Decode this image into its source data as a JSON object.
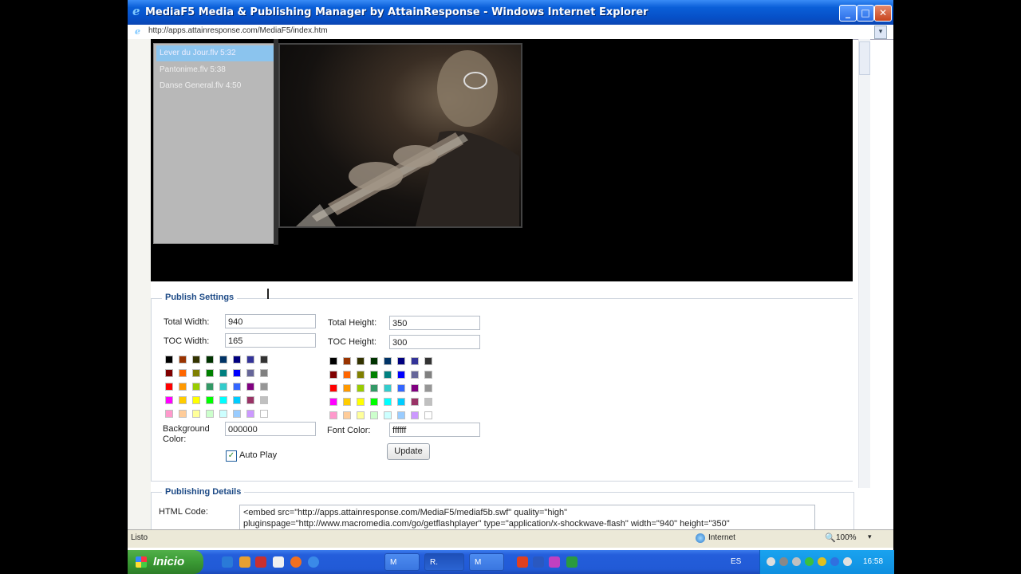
{
  "window": {
    "title": "MediaF5 Media & Publishing Manager by AttainResponse - Windows Internet Explorer",
    "address": "http://apps.attainresponse.com/MediaF5/index.htm"
  },
  "player": {
    "playlist": [
      {
        "label": "Lever du Jour.flv    5:32",
        "selected": true
      },
      {
        "label": "Pantonime.flv    5:38",
        "selected": false
      },
      {
        "label": "Danse General.flv    4:50",
        "selected": false
      }
    ]
  },
  "publish_settings": {
    "legend": "Publish Settings",
    "total_width_label": "Total Width:",
    "total_width_value": "940",
    "toc_width_label": "TOC Width:",
    "toc_width_value": "165",
    "total_height_label": "Total Height:",
    "total_height_value": "350",
    "toc_height_label": "TOC Height:",
    "toc_height_value": "300",
    "background_color_label_1": "Background",
    "background_color_label_2": "Color:",
    "background_color_value": "000000",
    "font_color_label": "Font Color:",
    "font_color_value": "ffffff",
    "auto_play_label": "Auto Play",
    "auto_play_checked": true,
    "update_button": "Update",
    "palette": [
      [
        "#000000",
        "#993300",
        "#333300",
        "#003300",
        "#003366",
        "#000080",
        "#333399",
        "#333333"
      ],
      [
        "#800000",
        "#FF6600",
        "#808000",
        "#008000",
        "#008080",
        "#0000FF",
        "#666699",
        "#808080"
      ],
      [
        "#FF0000",
        "#FF9900",
        "#99CC00",
        "#339966",
        "#33CCCC",
        "#3366FF",
        "#800080",
        "#969696"
      ],
      [
        "#FF00FF",
        "#FFCC00",
        "#FFFF00",
        "#00FF00",
        "#00FFFF",
        "#00CCFF",
        "#993366",
        "#C0C0C0"
      ],
      [
        "#FF99CC",
        "#FFCC99",
        "#FFFF99",
        "#CCFFCC",
        "#CCFFFF",
        "#99CCFF",
        "#CC99FF",
        "#FFFFFF"
      ]
    ]
  },
  "publishing_details": {
    "legend": "Publishing Details",
    "html_code_label": "HTML Code:",
    "html_code_line1": "<embed src=\"http://apps.attainresponse.com/MediaF5/mediaf5b.swf\" quality=\"high\"",
    "html_code_line2": "pluginspage=\"http://www.macromedia.com/go/getflashplayer\" type=\"application/x-shockwave-flash\" width=\"940\" height=\"350\""
  },
  "statusbar": {
    "status": "Listo",
    "zone": "Internet",
    "zoom": "100%"
  },
  "taskbar": {
    "start": "Inicio",
    "tasks": [
      {
        "label": "M",
        "active": false
      },
      {
        "label": "R.",
        "active": true
      },
      {
        "label": "M",
        "active": false
      }
    ],
    "language": "ES",
    "clock": "16:58"
  },
  "colors": {
    "titlebar": "#0a5fd8",
    "taskbar": "#245edb",
    "start": "#3a9a34",
    "legend": "#1d4a86",
    "toc_selected": "#8bc4ee"
  }
}
